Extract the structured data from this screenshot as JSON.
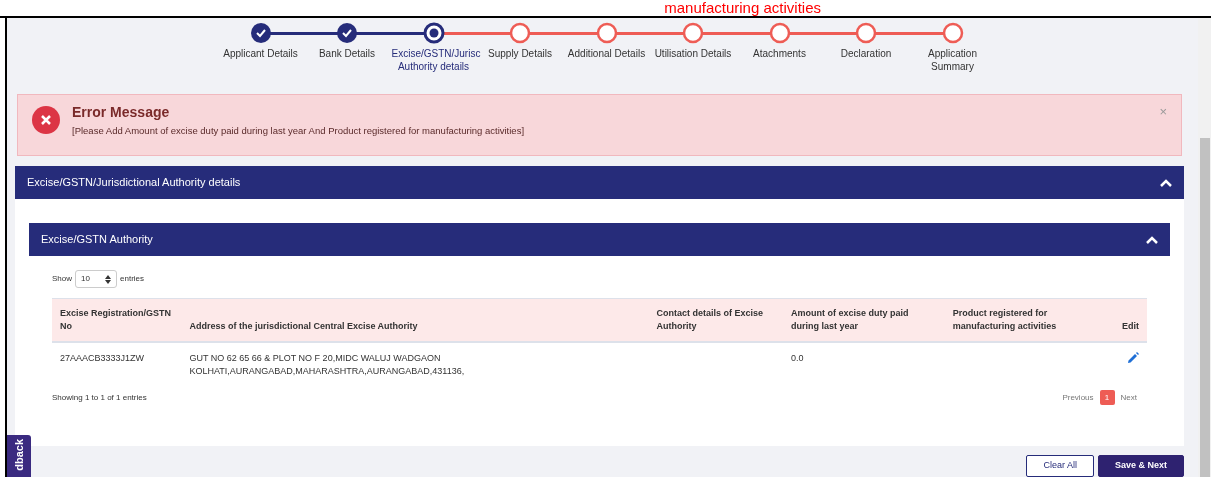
{
  "top_banner": {
    "text": "manufacturing activities"
  },
  "steps": [
    {
      "label": "Applicant Details",
      "kind": "done"
    },
    {
      "label": "Bank Details",
      "kind": "done"
    },
    {
      "label": "Excise/GSTN/Jurisc Authority details",
      "kind": "current"
    },
    {
      "label": "Supply Details",
      "kind": "todo"
    },
    {
      "label": "Additional Details",
      "kind": "todo"
    },
    {
      "label": "Utilisation Details",
      "kind": "todo"
    },
    {
      "label": "Atachments",
      "kind": "todo"
    },
    {
      "label": "Declaration",
      "kind": "todo"
    },
    {
      "label": "Application Summary",
      "kind": "todo"
    }
  ],
  "error": {
    "title": "Error Message",
    "message": "[Please Add Amount of excise duty paid during last year And Product registered for manufacturing activities]",
    "close": "×"
  },
  "section": {
    "title": "Excise/GSTN/Jurisdictional Authority details",
    "expanded": true
  },
  "subsection": {
    "title": "Excise/GSTN Authority",
    "expanded": true
  },
  "length_menu": {
    "before": "Show",
    "value": "10",
    "after": "entries"
  },
  "table": {
    "columns": [
      "Excise Registration/GSTN No",
      "Address of the jurisdictional Central Excise Authority",
      "Contact details of Excise Authority",
      "Amount of excise duty paid during last year",
      "Product registered for manufacturing activities",
      "Edit"
    ],
    "rows": [
      {
        "cells": [
          "27AAACB3333J1ZW",
          "GUT NO 62 65 66 & PLOT NO F 20,MIDC WALUJ WADGAON KOLHATI,AURANGABAD,MAHARASHTRA,AURANGABAD,431136,",
          "",
          "0.0",
          ""
        ]
      }
    ]
  },
  "info": "Showing 1 to 1 of 1 entries",
  "pagination": {
    "previous": "Previous",
    "pages": [
      {
        "label": "1",
        "selected": true
      }
    ],
    "next": "Next"
  },
  "buttons": [
    {
      "label": "Clear All",
      "kind": "outline"
    },
    {
      "label": "Save & Next",
      "kind": "primary"
    }
  ],
  "feedback_tab": "dback"
}
